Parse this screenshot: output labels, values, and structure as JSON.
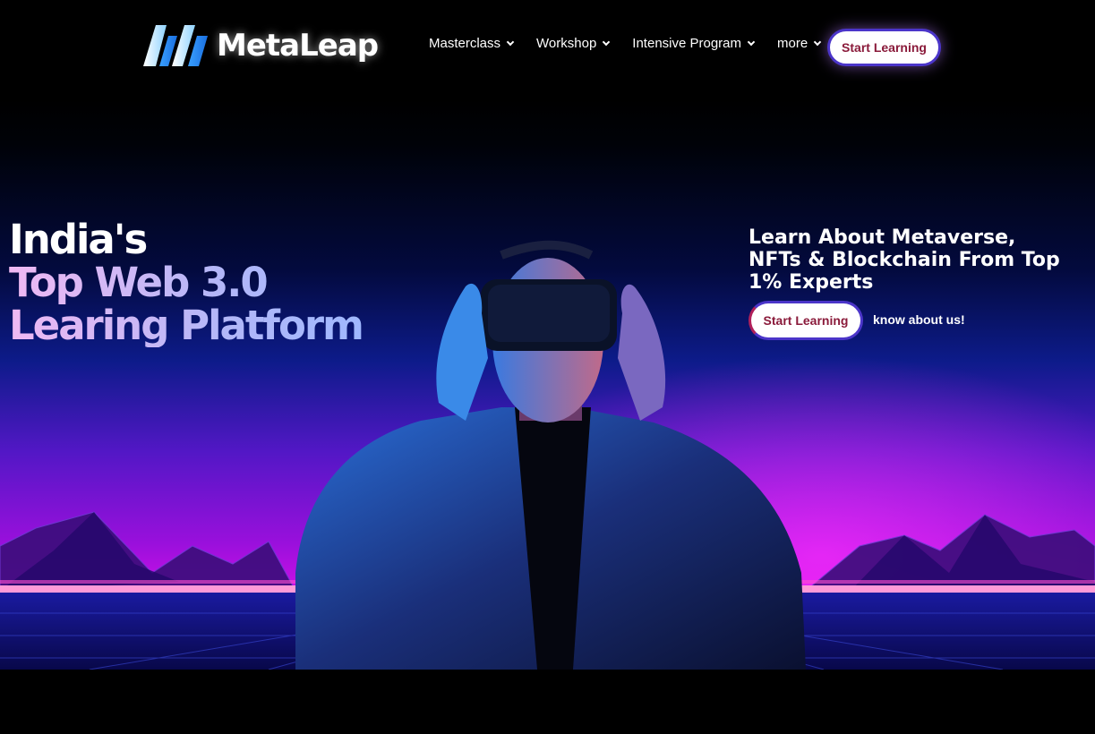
{
  "brand": {
    "name": "MetaLeap",
    "logo_icon": "metaleap-logo-icon"
  },
  "nav": {
    "items": [
      {
        "label": "Masterclass",
        "icon": "chevron-down-icon"
      },
      {
        "label": "Workshop",
        "icon": "chevron-down-icon"
      },
      {
        "label": "Intensive Program",
        "icon": "chevron-down-icon"
      },
      {
        "label": "more",
        "icon": "chevron-down-icon"
      }
    ],
    "cta_label": "Start Learning"
  },
  "hero": {
    "headline": {
      "line1": "India's",
      "line2": "Top Web 3.0",
      "line3": "Learing Platform"
    },
    "subheading": "Learn About Metaverse, NFTs & Blockchain From Top 1% Experts",
    "cta_label": "Start Learning",
    "secondary_link": "know about us!",
    "image_alt": "Man wearing VR headset in neon synthwave landscape"
  },
  "colors": {
    "accent_text": "#8a1a3a",
    "button_border": "#4b35c9",
    "neon_magenta": "#c910e6",
    "deep_blue": "#0d1b8a"
  }
}
